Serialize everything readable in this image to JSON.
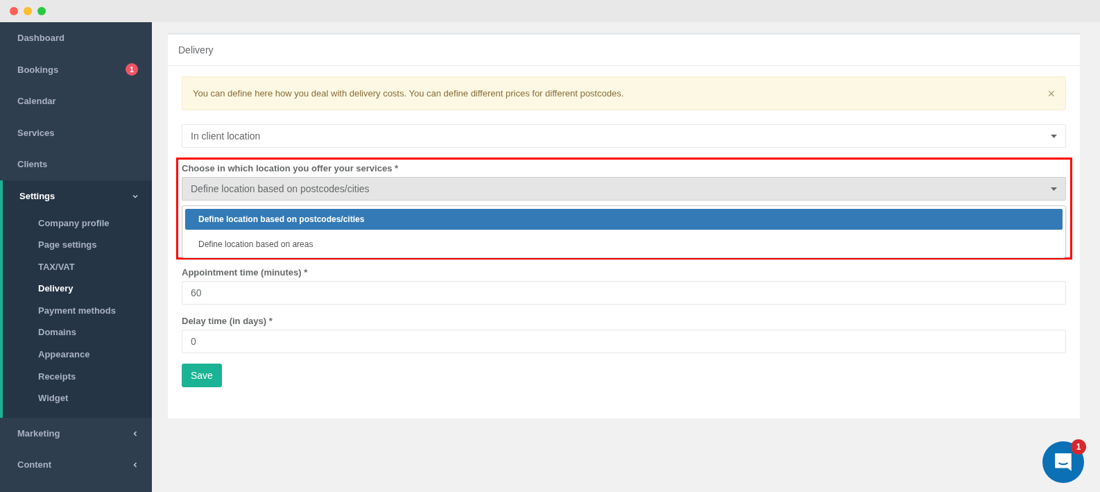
{
  "sidebar": {
    "items": [
      {
        "label": "Dashboard",
        "kind": "link"
      },
      {
        "label": "Bookings",
        "kind": "link",
        "badge": "1"
      },
      {
        "label": "Calendar",
        "kind": "link"
      },
      {
        "label": "Services",
        "kind": "link"
      },
      {
        "label": "Clients",
        "kind": "link"
      },
      {
        "label": "Settings",
        "kind": "group",
        "expanded": true,
        "children": [
          {
            "label": "Company profile",
            "selected": false
          },
          {
            "label": "Page settings",
            "selected": false
          },
          {
            "label": "TAX/VAT",
            "selected": false
          },
          {
            "label": "Delivery",
            "selected": true
          },
          {
            "label": "Payment methods",
            "selected": false
          },
          {
            "label": "Domains",
            "selected": false
          },
          {
            "label": "Appearance",
            "selected": false
          },
          {
            "label": "Receipts",
            "selected": false
          },
          {
            "label": "Widget",
            "selected": false
          }
        ]
      },
      {
        "label": "Marketing",
        "kind": "group",
        "expanded": false
      },
      {
        "label": "Content",
        "kind": "group",
        "expanded": false
      }
    ]
  },
  "card": {
    "title": "Delivery",
    "alert": {
      "text": "You can define here how you deal with delivery costs. You can define different prices for different postcodes.",
      "close": "×"
    },
    "delivery_select": {
      "value": "In client location"
    },
    "location_field": {
      "label": "Choose in which location you offer your services *",
      "value": "Define location based on postcodes/cities",
      "options": [
        {
          "label": "Define location based on postcodes/cities",
          "selected": true
        },
        {
          "label": "Define location based on areas",
          "selected": false
        }
      ]
    },
    "fields": [
      {
        "label": "Appointment time (minutes) *",
        "value": "60"
      },
      {
        "label": "Delay time (in days) *",
        "value": "0"
      }
    ],
    "save": "Save"
  },
  "chat": {
    "badge": "1"
  }
}
